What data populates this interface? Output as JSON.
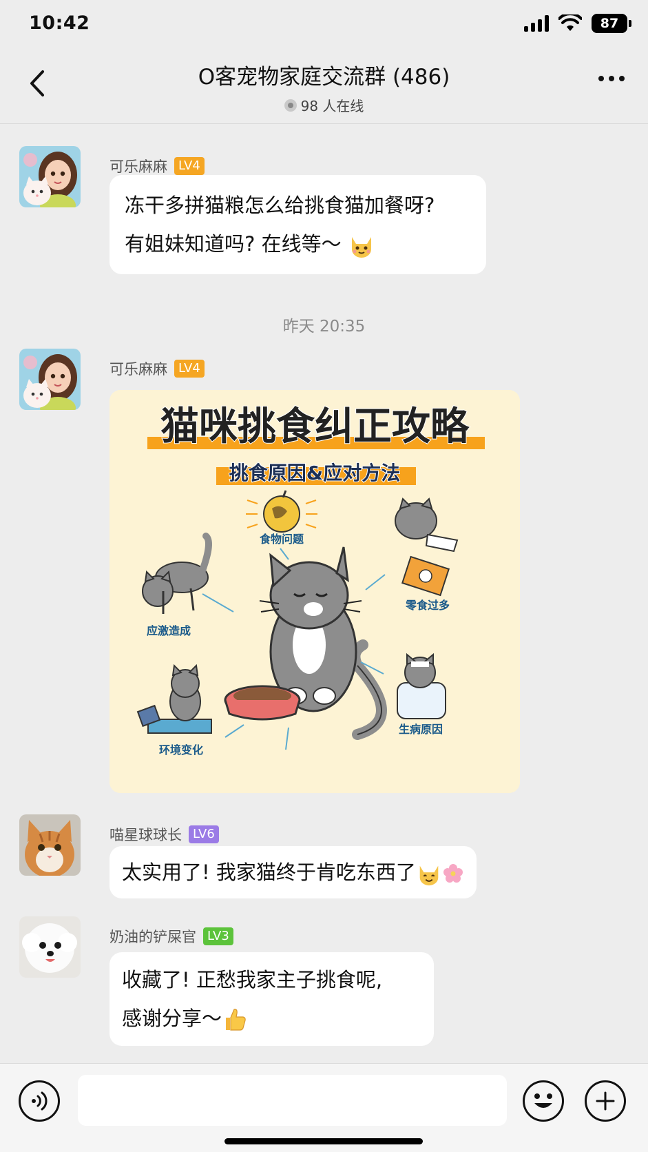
{
  "status_bar": {
    "time": "10:42",
    "battery": "87"
  },
  "header": {
    "title": "O客宠物家庭交流群 (486)",
    "online": "98 人在线"
  },
  "messages": [
    {
      "sender": "可乐麻麻",
      "level": "LV4",
      "level_color": "#f5a623",
      "lines": [
        "冻干多拼猫粮怎么给挑食猫加餐呀?",
        "有姐妹知道吗? 在线等～"
      ]
    },
    {
      "sender": "可乐麻麻",
      "level": "LV4",
      "level_color": "#f5a623"
    },
    {
      "sender": "喵星球球长",
      "level": "LV6",
      "level_color": "#9b7be6",
      "lines": [
        "太实用了! 我家猫终于肯吃东西了"
      ]
    },
    {
      "sender": "奶油的铲屎官",
      "level": "LV3",
      "level_color": "#5cc33b",
      "lines": [
        "收藏了! 正愁我家主子挑食呢,",
        "感谢分享～"
      ]
    }
  ],
  "timestamp": "昨天 20:35",
  "infographic": {
    "title": "猫咪挑食纠正攻略",
    "subtitle": "挑食原因&应对方法",
    "labels": [
      "食物问题",
      "零食过多",
      "应激造成",
      "生病原因",
      "环境变化"
    ]
  },
  "input": {
    "placeholder": ""
  }
}
